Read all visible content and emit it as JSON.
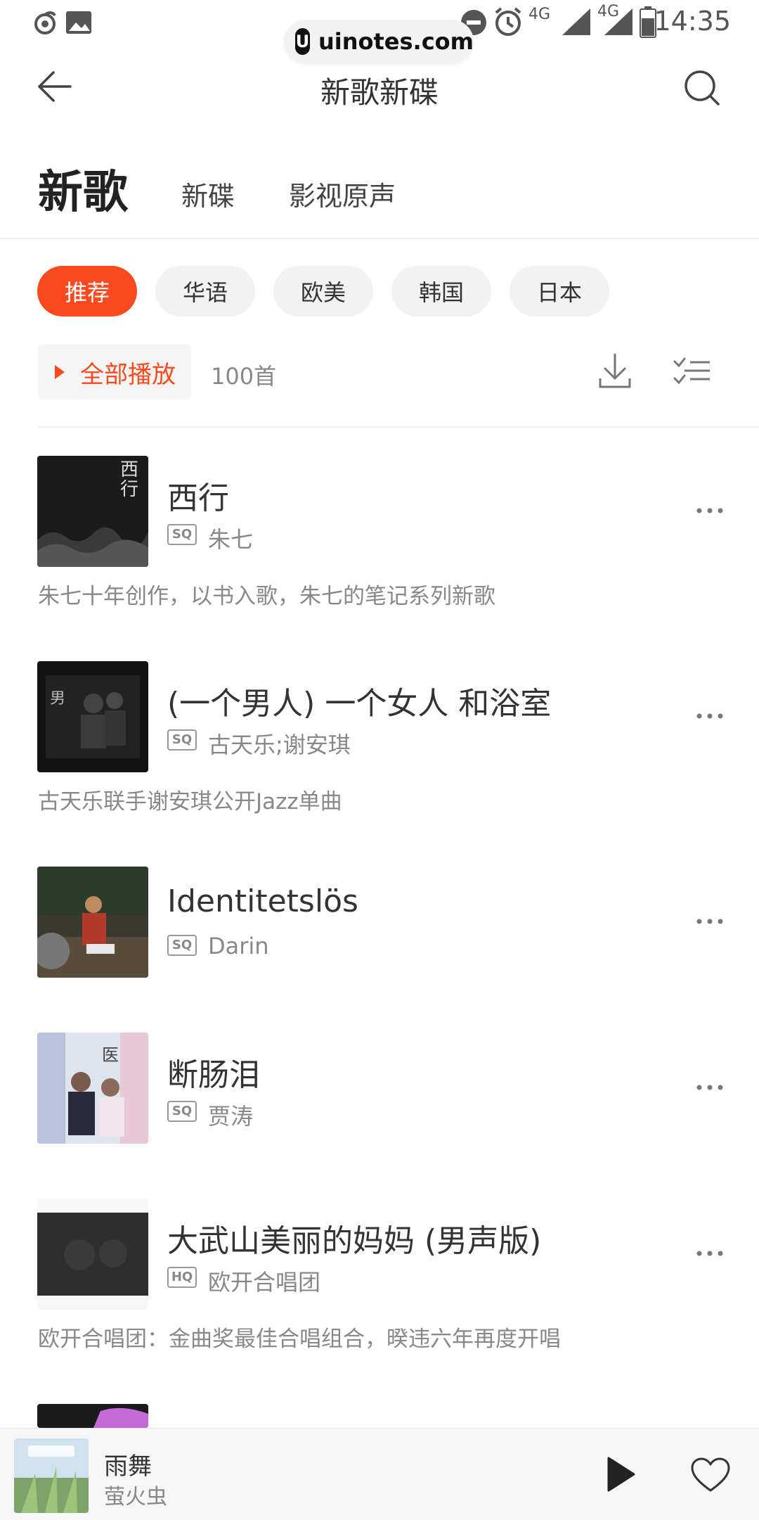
{
  "status_bar": {
    "time": "14:35",
    "network_1": "4G",
    "network_2": "4G"
  },
  "watermark": {
    "text": "uinotes.com",
    "logo": "U"
  },
  "header": {
    "title": "新歌新碟"
  },
  "tabs": [
    {
      "label": "新歌",
      "active": true
    },
    {
      "label": "新碟",
      "active": false
    },
    {
      "label": "影视原声",
      "active": false
    }
  ],
  "chips": [
    {
      "label": "推荐",
      "active": true
    },
    {
      "label": "华语",
      "active": false
    },
    {
      "label": "欧美",
      "active": false
    },
    {
      "label": "韩国",
      "active": false
    },
    {
      "label": "日本",
      "active": false
    }
  ],
  "play_all": {
    "label": "全部播放",
    "count": "100首"
  },
  "songs": [
    {
      "title": "西行",
      "quality": "SQ",
      "artist": "朱七",
      "desc": "朱七十年创作，以书入歌，朱七的笔记系列新歌"
    },
    {
      "title": "(一个男人) 一个女人 和浴室",
      "quality": "SQ",
      "artist": "古天乐;谢安琪",
      "desc": "古天乐联手谢安琪公开Jazz单曲"
    },
    {
      "title": "Identitetslös",
      "quality": "SQ",
      "artist": "Darin",
      "desc": ""
    },
    {
      "title": "断肠泪",
      "quality": "SQ",
      "artist": "贾涛",
      "desc": ""
    },
    {
      "title": "大武山美丽的妈妈 (男声版)",
      "quality": "HQ",
      "artist": "欧开合唱团",
      "desc": "欧开合唱团：金曲奖最佳合唱组合，暌违六年再度开唱"
    }
  ],
  "player": {
    "title": "雨舞",
    "artist": "萤火虫"
  },
  "colors": {
    "accent": "#fb4a1e"
  }
}
